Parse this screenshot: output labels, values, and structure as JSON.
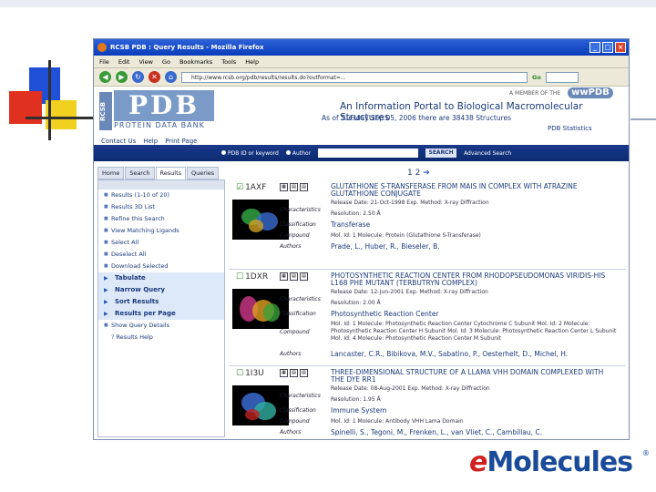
{
  "browser": {
    "window_title": "RCSB PDB : Query Results - Mozilla Firefox",
    "menu": [
      "File",
      "Edit",
      "View",
      "Go",
      "Bookmarks",
      "Tools",
      "Help"
    ],
    "url": "http://www.rcsb.org/pdb/results/results.do?outformat=...",
    "go_label": "Go"
  },
  "pdb": {
    "logo_vertical": "RCSB",
    "logo": "PDB",
    "logo_sub": "PROTEIN DATA BANK",
    "member_of": "A MEMBER OF THE",
    "member_pdb": "wwPDB",
    "portal_title": "An Information Portal to Biological Macromolecular Structures",
    "date_line": "As of Tuesday Sep 05, 2006 there are 38438 Structures",
    "nav_links": [
      "Contact Us",
      "Help",
      "Print Page"
    ],
    "stats_link": "PDB Statistics",
    "search": {
      "option_pdb": "PDB ID or keyword",
      "option_author": "Author",
      "button": "SEARCH",
      "advanced": "Advanced Search"
    }
  },
  "left": {
    "tabs": [
      "Home",
      "Search",
      "Results",
      "Queries"
    ],
    "items": [
      "Results (1-10 of 20)",
      "Results 3D List",
      "Refine this Search",
      "View Matching Ligands",
      "Select All",
      "Deselect All",
      "Download Selected"
    ],
    "sections": [
      "Tabulate",
      "Narrow Query",
      "Sort Results",
      "Results per Page"
    ],
    "footer": [
      "Show Query Details",
      "Results Help"
    ]
  },
  "results": {
    "pager": "1 2",
    "labels": {
      "characteristics": "Characteristics",
      "classification": "Classification",
      "compound": "Compound",
      "authors": "Authors"
    },
    "items": [
      {
        "id": "1AXF",
        "title": "GLUTATHIONE S-TRANSFERASE FROM MAIS IN COMPLEX WITH ATRAZINE GLUTATHIONE CONJUGATE",
        "line1": "Release Date: 21-Oct-1998   Exp. Method: X-ray Diffraction",
        "line2": "Resolution: 2.50 Å",
        "classification": "Transferase",
        "compound": "Mol. Id: 1   Molecule: Protein (Glutathione S-Transferase)",
        "authors": "Prade, L., Huber, R., Bieseler, B."
      },
      {
        "id": "1DXR",
        "title": "PHOTOSYNTHETIC REACTION CENTER FROM RHODOPSEUDOMONAS VIRIDIS-HIS L168 PHE MUTANT (TERBUTRYN COMPLEX)",
        "line1": "Release Date: 12-Jun-2001   Exp. Method: X-ray Diffraction",
        "line2": "Resolution: 2.00 Å",
        "classification": "Photosynthetic Reaction Center",
        "compound": "Mol. Id: 1   Molecule: Photosynthetic Reaction Center Cytochrome C Subunit   Mol. Id: 2   Molecule: Photosynthetic Reaction Center H Subunit   Mol. Id: 3   Molecule: Photosynthetic Reaction Center L Subunit   Mol. Id: 4   Molecule: Photosynthetic Reaction Center M Subunit",
        "authors": "Lancaster, C.R., Bibikova, M.V., Sabatino, P., Oesterhelt, D., Michel, H."
      },
      {
        "id": "1I3U",
        "title": "THREE-DIMENSIONAL STRUCTURE OF A LLAMA VHH DOMAIN COMPLEXED WITH THE DYE RR1",
        "line1": "Release Date: 08-Aug-2001   Exp. Method: X-ray Diffraction",
        "line2": "Resolution: 1.95 Å",
        "classification": "Immune System",
        "compound": "Mol. Id: 1   Molecule: Antibody VHH Lama Domain",
        "authors": "Spinelli, S., Tegoni, M., Frenken, L., van Vliet, C., Cambillau, C."
      }
    ]
  },
  "brand": {
    "e": "e",
    "rest": "Molecules",
    "reg": "®"
  }
}
